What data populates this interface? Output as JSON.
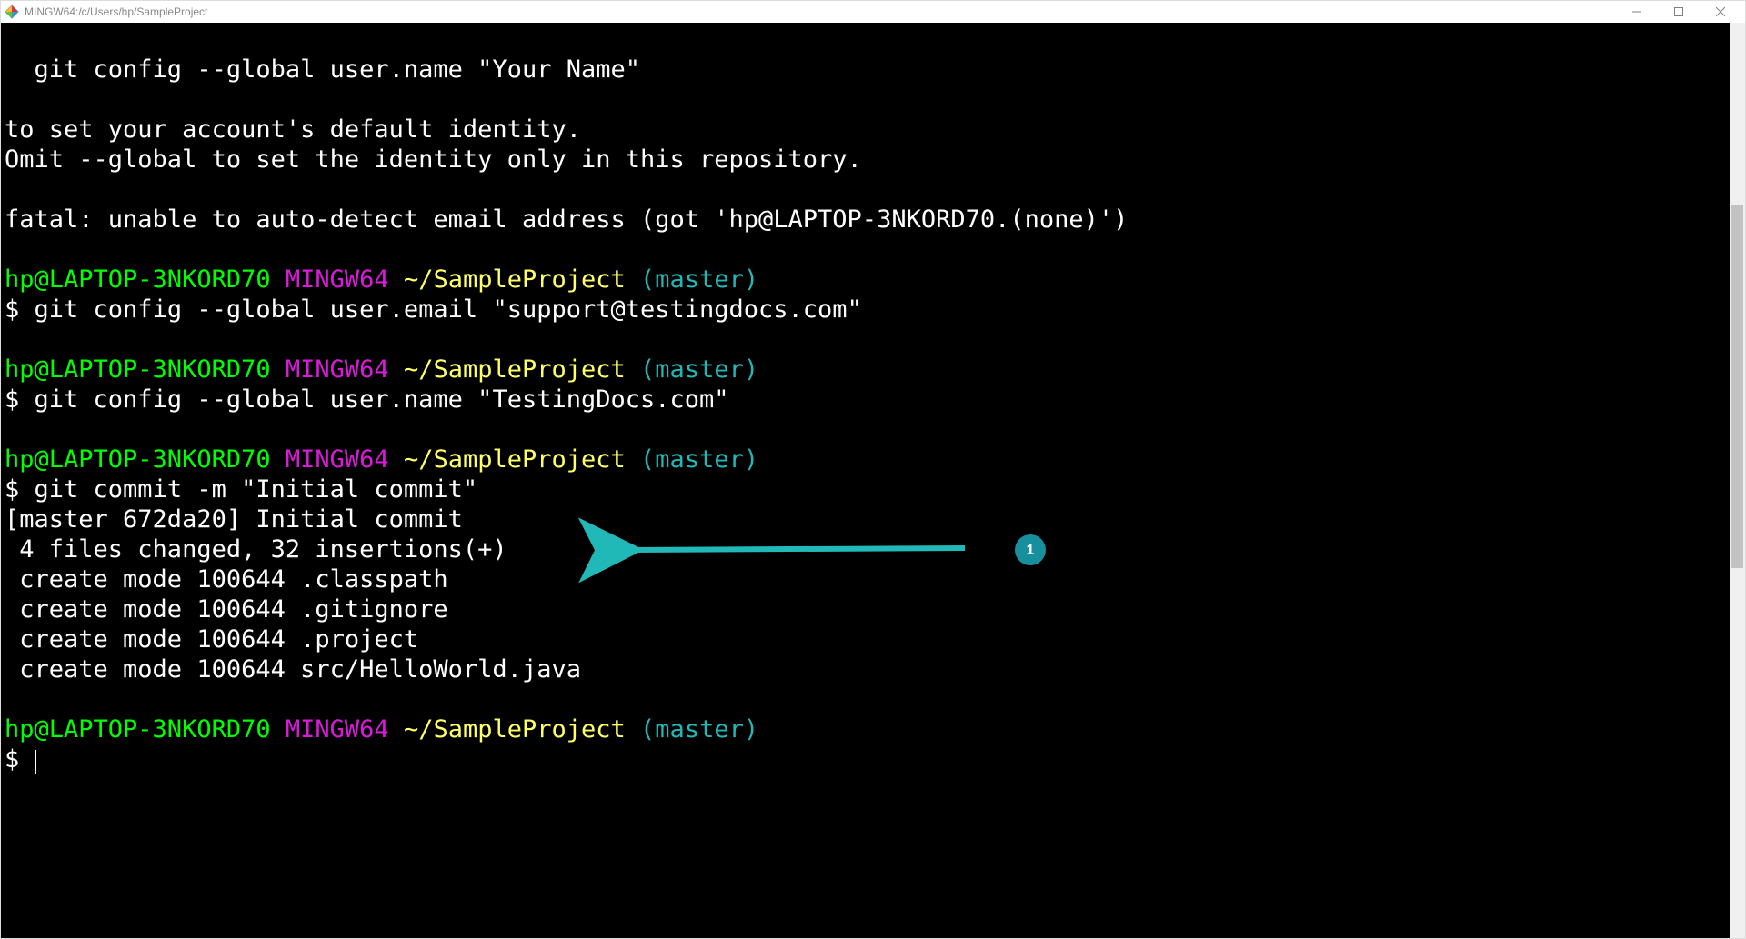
{
  "titlebar": {
    "title": "MINGW64:/c/Users/hp/SampleProject"
  },
  "prompt": {
    "user_host": "hp@LAPTOP-3NKORD70",
    "env": "MINGW64",
    "path": "~/SampleProject",
    "branch": "(master)",
    "symbol": "$"
  },
  "lines": {
    "l1": "  git config --global user.name \"Your Name\"",
    "l2": "",
    "l3": "to set your account's default identity.",
    "l4": "Omit --global to set the identity only in this repository.",
    "l5": "",
    "l6": "fatal: unable to auto-detect email address (got 'hp@LAPTOP-3NKORD70.(none)')",
    "l7": "",
    "cmd1": " git config --global user.email \"support@testingdocs.com\"",
    "cmd2": " git config --global user.name \"TestingDocs.com\"",
    "cmd3": " git commit -m \"Initial commit\"",
    "out1": "[master 672da20] Initial commit",
    "out2": " 4 files changed, 32 insertions(+)",
    "out3": " create mode 100644 .classpath",
    "out4": " create mode 100644 .gitignore",
    "out5": " create mode 100644 .project",
    "out6": " create mode 100644 src/HelloWorld.java"
  },
  "annotation": {
    "number": "1"
  }
}
